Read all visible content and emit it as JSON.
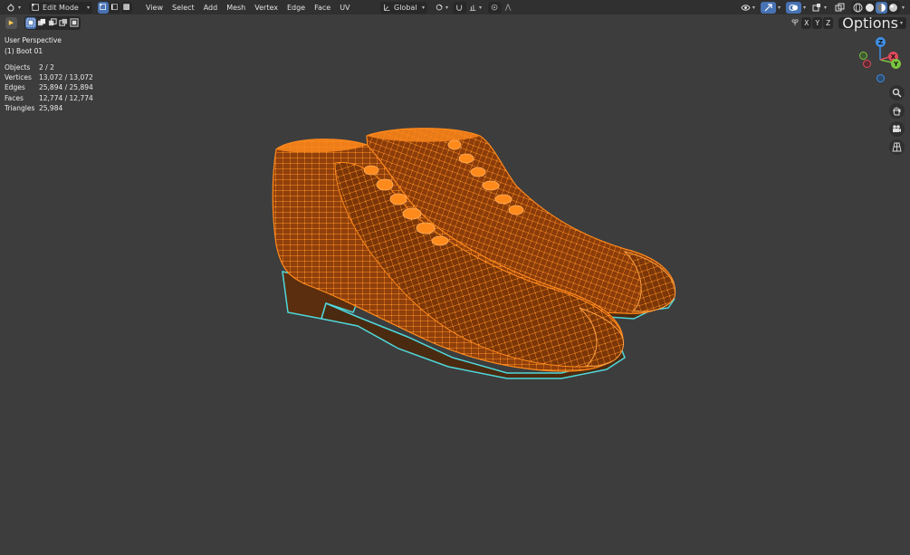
{
  "header": {
    "mode": "Edit Mode",
    "menus": [
      "View",
      "Select",
      "Add",
      "Mesh",
      "Vertex",
      "Edge",
      "Face",
      "UV"
    ],
    "transform_orientation": "Global"
  },
  "subheader": {
    "axes": [
      "X",
      "Y",
      "Z"
    ],
    "options_label": "Options"
  },
  "overlay": {
    "view_name": "User Perspective",
    "object_name": "(1) Boot 01"
  },
  "stats": [
    {
      "label": "Objects",
      "value": "2 / 2"
    },
    {
      "label": "Vertices",
      "value": "13,072 / 13,072"
    },
    {
      "label": "Edges",
      "value": "25,894 / 25,894"
    },
    {
      "label": "Faces",
      "value": "12,774 / 12,774"
    },
    {
      "label": "Triangles",
      "value": "25,984"
    }
  ],
  "gizmo": {
    "x_label": "X",
    "y_label": "Y",
    "z_label": "Z",
    "x_color": "#e04a5c",
    "y_color": "#7ac53e",
    "z_color": "#3f8de2"
  },
  "colors": {
    "mesh_orange": "#ff8a1c",
    "mesh_dark": "#8a3c0a",
    "seam_cyan": "#4fd7db",
    "viewport_bg": "#3d3d3d"
  }
}
